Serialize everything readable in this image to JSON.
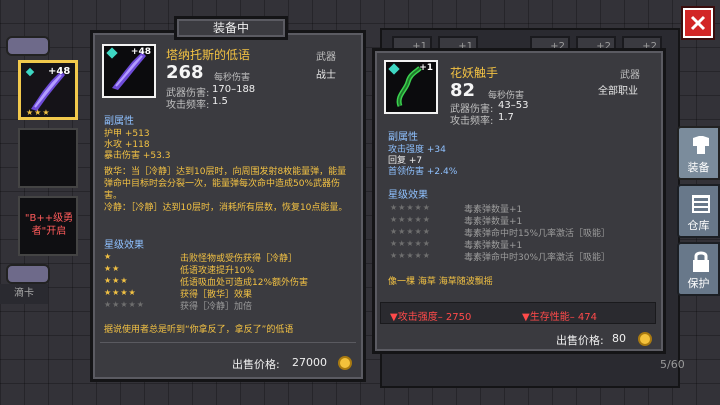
{
  "header": {
    "title": "装备中"
  },
  "left_column": {
    "equipped_plus": "+48",
    "equipped_stars": "★★★",
    "slot_text": "\"B++级勇者\"开启",
    "footer": "滴卡"
  },
  "card_a": {
    "name": "塔纳托斯的低语",
    "plus": "+48",
    "damage_per_sec": "268",
    "per_sec_label": "每秒伤害",
    "type_label": "武器",
    "class": "战士",
    "weapon_damage_label": "武器伤害:",
    "weapon_damage": "170–188",
    "attack_rate_label": "攻击频率:",
    "attack_rate": "1.5",
    "sub_attr_title": "副属性",
    "attrs": [
      "护甲 +513",
      "水攻 +118",
      "暴击伤害 +53.3"
    ],
    "description": "散华：当［冷静］达到10层时，向周围发射8枚能量弹，能量弹命中目标时会分裂一次，能量弹每次命中造成50%武器伤害。\n冷静：［冷静］达到10层时，消耗所有层数，恢复10点能量。",
    "star_title": "星级效果",
    "star_effects": [
      {
        "stars": "★",
        "text": "击败怪物或受伤获得［冷静］",
        "active": true
      },
      {
        "stars": "★★",
        "text": "低语攻速提升10%",
        "active": true
      },
      {
        "stars": "★★★",
        "text": "低语吸血处可造成12%额外伤害",
        "active": true
      },
      {
        "stars": "★★★★",
        "text": "获得［散华］效果",
        "active": true
      },
      {
        "stars": "★★★★★",
        "text": "获得［冷静］加倍",
        "active": false
      }
    ],
    "quote": "据说使用者总是听到“你拿反了，拿反了”的低语",
    "sell_label": "出售价格:",
    "sell_price": "27000"
  },
  "card_b": {
    "name": "花妖触手",
    "plus": "+1",
    "damage_per_sec": "82",
    "per_sec_label": "每秒伤害",
    "type_label": "武器",
    "class": "全部职业",
    "weapon_damage_label": "武器伤害:",
    "weapon_damage": "43–53",
    "attack_rate_label": "攻击频率:",
    "attack_rate": "1.7",
    "sub_attr_title": "副属性",
    "attrs": [
      "攻击强度 +34",
      "回复 +7",
      "首领伤害 +2.4%"
    ],
    "star_title": "星级效果",
    "star_effects": [
      {
        "stars": "★★★★★",
        "text": "毒素弹数量+1"
      },
      {
        "stars": "★★★★★",
        "text": "毒素弹数量+1"
      },
      {
        "stars": "★★★★★",
        "text": "毒素弹命中时15%几率激活［吸能］"
      },
      {
        "stars": "★★★★★",
        "text": "毒素弹数量+1"
      },
      {
        "stars": "★★★★★",
        "text": "毒素弹命中时30%几率激活［吸能］"
      }
    ],
    "quote": "像一棵 海草 海草随波飘摇",
    "compare_attack": "▼攻击强度– 2750",
    "compare_survival": "▼生存性能– 474",
    "sell_label": "出售价格:",
    "sell_price": "80"
  },
  "right_menu": {
    "equip": "装备",
    "warehouse": "仓库",
    "protect": "保护"
  },
  "bg_slots": [
    "+1",
    "+1",
    "+2",
    "+2",
    "+2"
  ],
  "page_count": "5/60",
  "colors": {
    "gold": "#f3c243",
    "blue": "#8fc1ff",
    "red": "#ff4a4a",
    "close": "#d22626"
  }
}
